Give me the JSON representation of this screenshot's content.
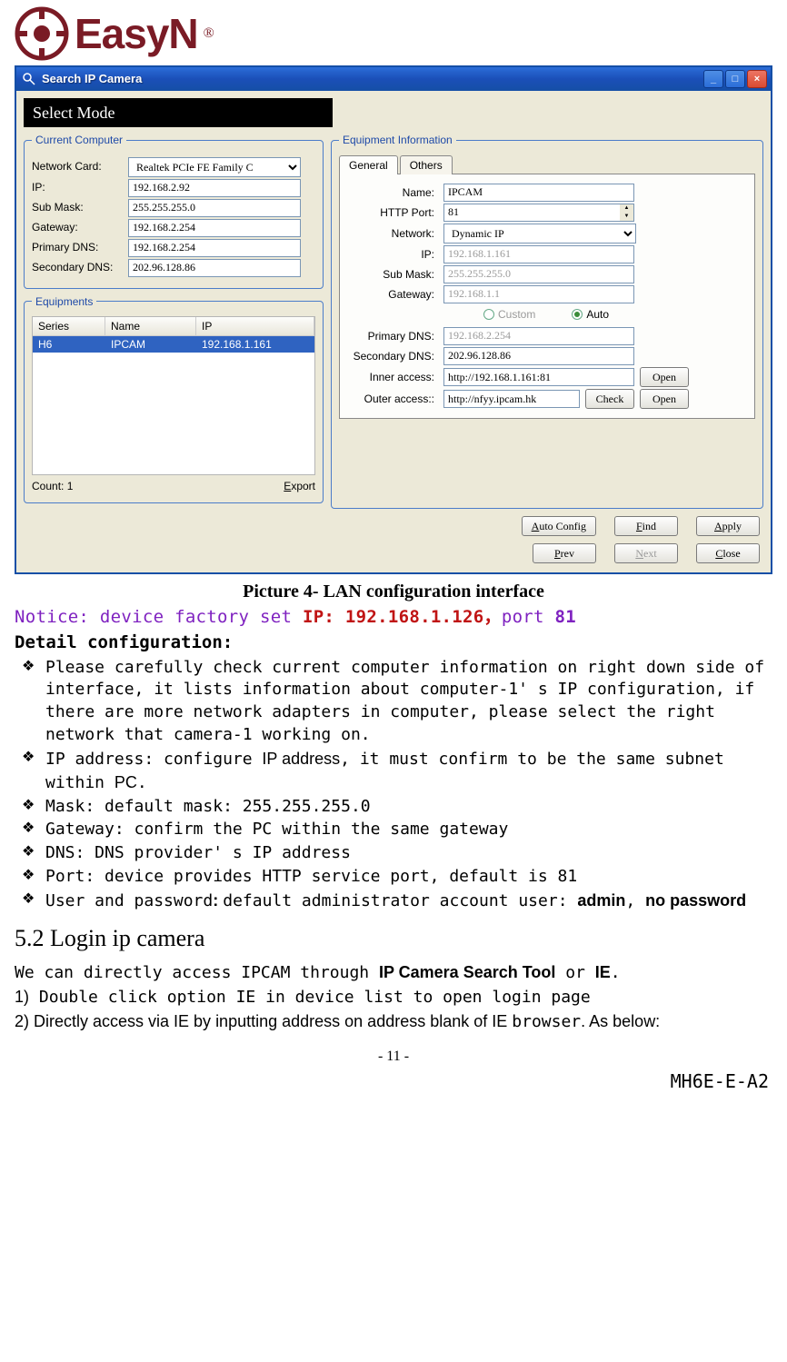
{
  "logo": {
    "brand": "EasyN",
    "reg": "®"
  },
  "window": {
    "title": "Search IP Camera",
    "selectMode": "Select Mode",
    "groups": {
      "currentComputer": {
        "legend": "Current Computer",
        "labels": {
          "networkCard": "Network Card:",
          "ip": "IP:",
          "subMask": "Sub Mask:",
          "gateway": "Gateway:",
          "primaryDNS": "Primary DNS:",
          "secondaryDNS": "Secondary DNS:"
        },
        "values": {
          "networkCard": "Realtek PCIe FE Family C",
          "ip": "192.168.2.92",
          "subMask": "255.255.255.0",
          "gateway": "192.168.2.254",
          "primaryDNS": "192.168.2.254",
          "secondaryDNS": "202.96.128.86"
        }
      },
      "equipments": {
        "legend": "Equipments",
        "headers": {
          "series": "Series",
          "name": "Name",
          "ip": "IP"
        },
        "row": {
          "series": "H6",
          "name": "IPCAM",
          "ip": "192.168.1.161"
        },
        "count_label": "Count: 1",
        "export": "Export"
      },
      "equipmentInfo": {
        "legend": "Equipment Information",
        "tabs": {
          "general": "General",
          "others": "Others"
        },
        "labels": {
          "name": "Name:",
          "httpPort": "HTTP Port:",
          "network": "Network:",
          "ip": "IP:",
          "subMask": "Sub Mask:",
          "gateway": "Gateway:",
          "custom": "Custom",
          "auto": "Auto",
          "primaryDNS": "Primary DNS:",
          "secondaryDNS": "Secondary DNS:",
          "inner": "Inner access:",
          "outer": "Outer access::"
        },
        "values": {
          "name": "IPCAM",
          "httpPort": "81",
          "network": "Dynamic IP",
          "ip": "192.168.1.161",
          "subMask": "255.255.255.0",
          "gateway": "192.168.1.1",
          "primaryDNS": "192.168.2.254",
          "secondaryDNS": "202.96.128.86",
          "inner": "http://192.168.1.161:81",
          "outer": "http://nfyy.ipcam.hk"
        },
        "buttons": {
          "open": "Open",
          "check": "Check"
        }
      }
    },
    "buttons": {
      "autoConfig": "Auto Config",
      "find": "Find",
      "apply": "Apply",
      "prev": "Prev",
      "next": "Next",
      "close": "Close"
    }
  },
  "body": {
    "caption": "Picture 4- LAN configuration interface",
    "notice_pre": "Notice: device factory set ",
    "notice_ip": "IP: 192.168.1.126，",
    "notice_port_word": "port ",
    "notice_port": "81",
    "detail_hdr": "Detail configuration:",
    "bullets": {
      "b1": "Please carefully check current computer information on right down side of interface, it lists information about computer-1' s IP configuration, if there are more network adapters in computer, please select the right network that camera-1 working on.",
      "b2a": "IP address: configure ",
      "b2b": "IP address",
      "b2c": ", it must confirm to be the same subnet within ",
      "b2d": "PC",
      "b2e": ".",
      "b3": "Mask: default mask: 255.255.255.0",
      "b4": "Gateway: confirm the PC within the same gateway",
      "b5": "DNS: DNS provider' s IP address",
      "b6": "Port: device provides HTTP service port, default is 81",
      "b7a": "User and password",
      "b7b": ": ",
      "b7c": "default administrator account user: ",
      "b7d": "admin",
      "b7e": ", ",
      "b7f": "no password"
    },
    "section": "5.2 Login ip camera",
    "para1a": "We can directly access IPCAM through ",
    "para1b": "IP Camera Search Tool",
    "para1c": " or ",
    "para1d": "IE",
    "para1e": ".",
    "step1_num": "1)",
    "step1": " Double click option IE in device list to open login page",
    "step2a": " 2) Directly access via IE by inputting address on address blank of IE ",
    "step2b": "browser",
    "step2c": ". As below:",
    "pagenum": "- 11 -",
    "doccode": "MH6E-E-A2"
  }
}
